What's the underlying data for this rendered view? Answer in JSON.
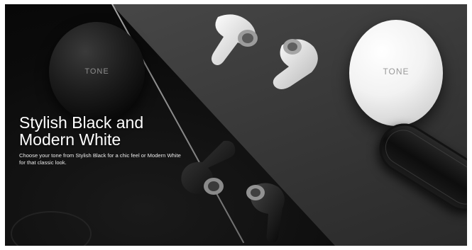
{
  "banner": {
    "headline_line1": "Stylish Black and",
    "headline_line2": "Modern White",
    "description": "Choose your tone from Stylish Black for a chic feel or Modern White for that classic look."
  },
  "products": {
    "black_case_logo": "TONE",
    "white_case_logo": "TONE"
  },
  "colors": {
    "black_surface": "#0b0b0b",
    "gray_surface": "#3b3b3b",
    "text": "#ffffff"
  }
}
